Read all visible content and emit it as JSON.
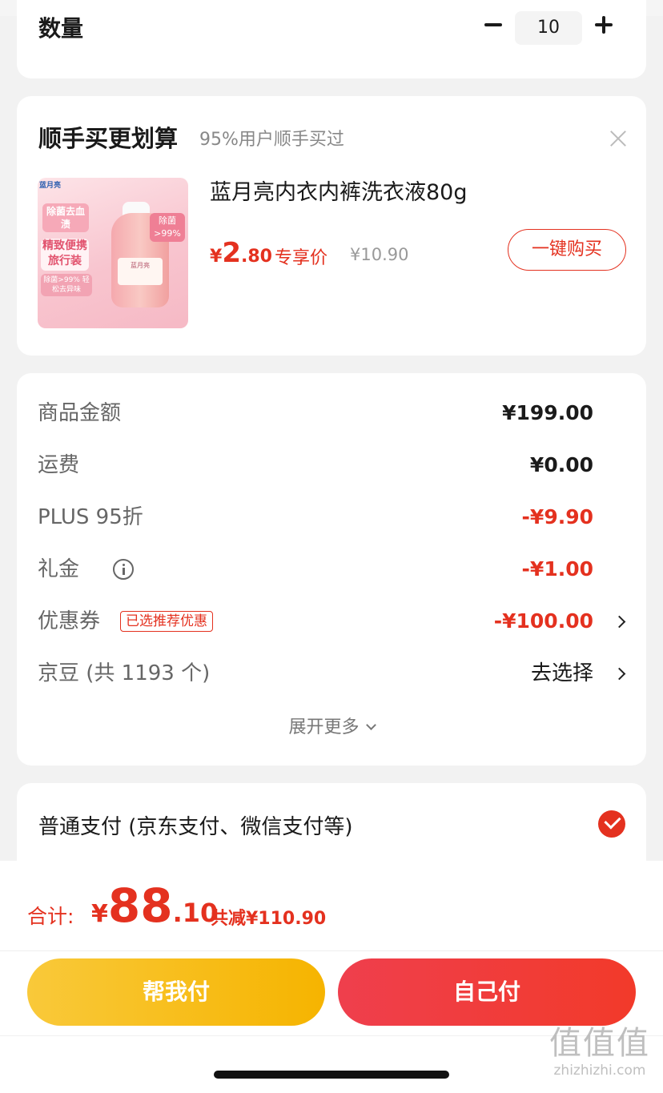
{
  "quantity": {
    "label": "数量",
    "value": "10"
  },
  "upsell": {
    "title": "顺手买更划算",
    "subtitle": "95%用户顺手买过",
    "product": {
      "name": "蓝月亮内衣内裤洗衣液80g",
      "price_symbol": "¥",
      "price_int": "2",
      "price_dec": ".80",
      "exclusive_label": "专享价",
      "original_price": "¥10.90",
      "buy_button": "一键购买",
      "image_text": {
        "brand": "蓝月亮",
        "tag1": "除菌去血渍",
        "tag2": "精致便携旅行装",
        "tag3": "除菌>99% 轻松去异味",
        "badge": "除菌>99%"
      }
    }
  },
  "summary": {
    "rows": [
      {
        "label": "商品金额",
        "value": "¥199.00"
      },
      {
        "label": "运费",
        "value": "¥0.00"
      },
      {
        "label": "PLUS 95折",
        "value": "-¥9.90"
      },
      {
        "label": "礼金",
        "value": "-¥1.00"
      },
      {
        "label": "优惠券",
        "tag": "已选推荐优惠",
        "value": "-¥100.00"
      },
      {
        "label": "京豆 (共 1193 个)",
        "value": "去选择"
      }
    ],
    "expand_more": "展开更多"
  },
  "payment": {
    "option_label": "普通支付 (京东支付、微信支付等)",
    "selected": true
  },
  "footer": {
    "total_label": "合计:",
    "total_symbol": "¥",
    "total_int": "88",
    "total_dec": ".10",
    "total_saved": "共减¥110.90",
    "help_pay": "帮我付",
    "self_pay": "自己付"
  },
  "watermark": {
    "big": "值值值",
    "small": "zhizhizhi.com"
  },
  "colors": {
    "accent_red": "#e4311f",
    "help_yellow": "#f6b400",
    "self_red": "#f23a2a"
  }
}
